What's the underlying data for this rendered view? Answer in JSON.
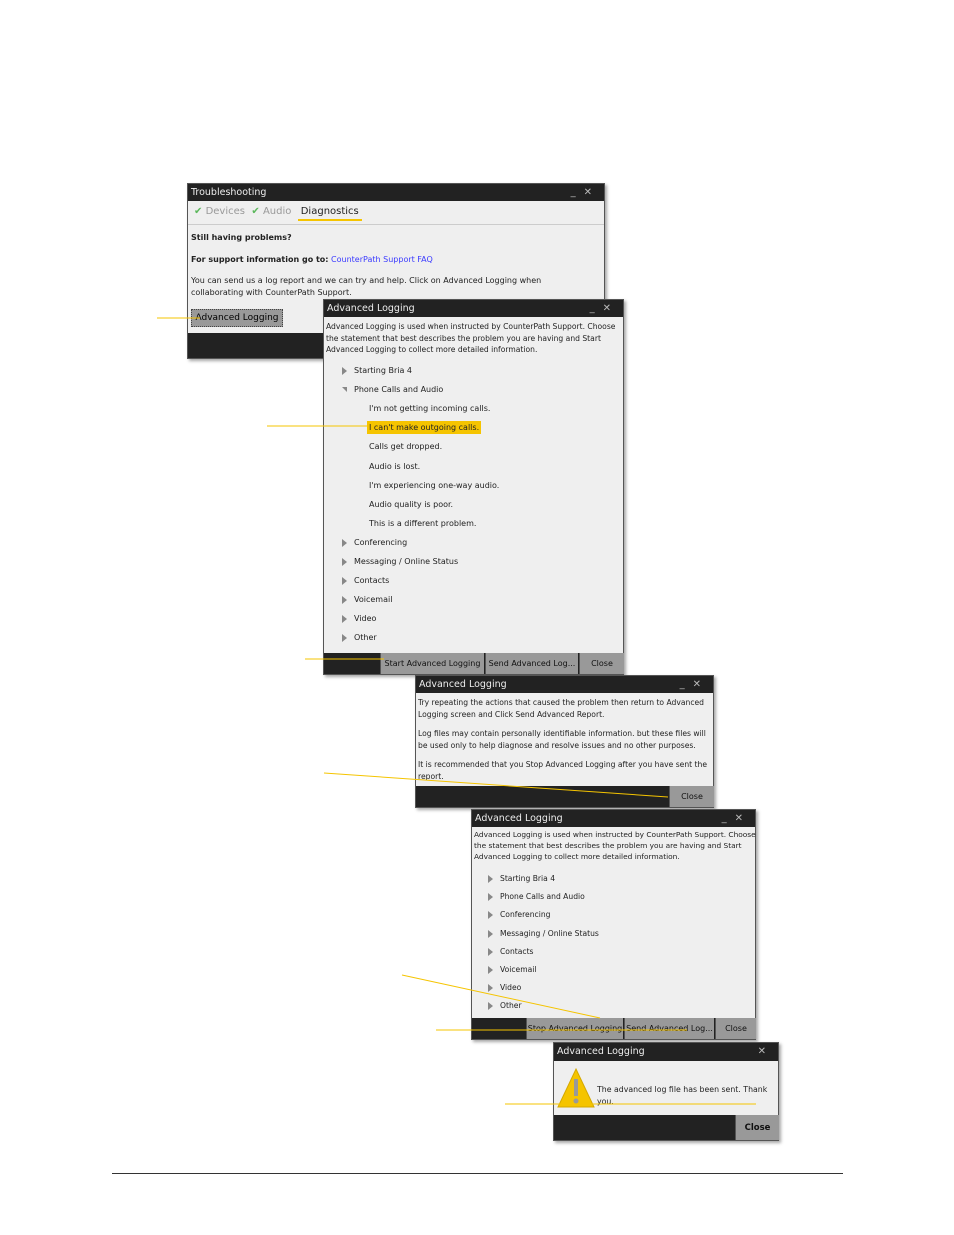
{
  "troubleshooting": {
    "title": "Troubleshooting",
    "tabs": [
      "Devices",
      "Audio",
      "Diagnostics"
    ],
    "heading": "Still having problems?",
    "support_label": "For support information go to:",
    "support_link": "CounterPath Support FAQ",
    "body": "You can send us a log report and we can try and help. Click on Advanced Logging when collaborating with CounterPath Support.",
    "button": "Advanced Logging"
  },
  "adv1": {
    "title": "Advanced Logging",
    "intro": "Advanced Logging is used when instructed by CounterPath Support. Choose the statement that best describes the problem you are having and Start Advanced Logging to collect more detailed information.",
    "categories": [
      "Starting Bria 4",
      "Phone Calls and Audio",
      "Conferencing",
      "Messaging / Online Status",
      "Contacts",
      "Voicemail",
      "Video",
      "Other"
    ],
    "sub_items": [
      "I'm not getting incoming calls.",
      "I can't make outgoing calls.",
      "Calls get dropped.",
      "Audio is lost.",
      "I'm experiencing one-way audio.",
      "Audio quality is poor.",
      "This is a different problem."
    ],
    "selected": "I can't make outgoing calls.",
    "buttons": [
      "Start Advanced Logging",
      "Send Advanced Log...",
      "Close"
    ]
  },
  "adv2": {
    "title": "Advanced Logging",
    "p1": "Try repeating the actions that caused the problem then return to Advanced Logging screen and Click Send Advanced Report.",
    "p2": "Log files may contain personally identifiable information. but these files will be used only to help diagnose and resolve issues and no other purposes.",
    "p3": "It is recommended that you Stop Advanced Logging after you have sent the report.",
    "close": "Close"
  },
  "adv3": {
    "title": "Advanced Logging",
    "intro": "Advanced Logging is used when instructed by CounterPath Support. Choose the statement that best describes the problem you are having and Start Advanced Logging to collect more detailed information.",
    "categories": [
      "Starting Bria 4",
      "Phone Calls and Audio",
      "Conferencing",
      "Messaging / Online Status",
      "Contacts",
      "Voicemail",
      "Video",
      "Other"
    ],
    "buttons": [
      "Stop Advanced Logging",
      "Send Advanced Log...",
      "Close"
    ]
  },
  "adv4": {
    "title": "Advanced Logging",
    "message": "The advanced log file has been sent. Thank you.",
    "close": "Close",
    "icon": "warning-icon"
  },
  "colors": {
    "accent": "#f5c400",
    "link": "#3a3aff",
    "check": "#5cb85c",
    "titlebar": "#222222"
  }
}
